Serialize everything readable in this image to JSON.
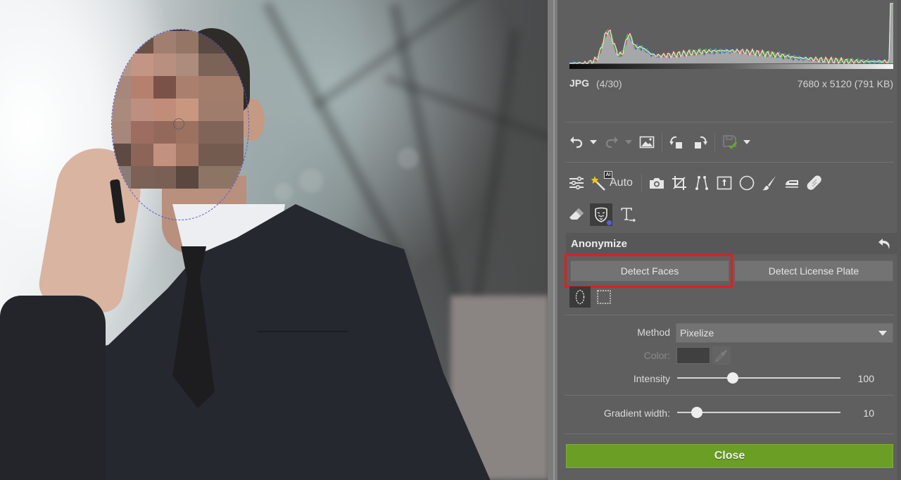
{
  "image": {
    "alt": "Man in dark suit on phone with pixelated face",
    "face_pixel_colors": [
      [
        "#c7b4a8",
        "#4d3f3a",
        "#2e2a27",
        "#403530",
        "#8d7364",
        "#000000"
      ],
      [
        "#5a4740",
        "#6b5247",
        "#a17f70",
        "#957566",
        "#5a4a44",
        "#000000"
      ],
      [
        "#b69586",
        "#c39584",
        "#b98f80",
        "#ad8b7d",
        "#7b6358",
        "#000000"
      ],
      [
        "#a6877a",
        "#b5806d",
        "#7a5247",
        "#ab7f6e",
        "#a27d6c",
        "#000000"
      ],
      [
        "#a98a7c",
        "#bd8f80",
        "#c08d79",
        "#c99780",
        "#a07c6d",
        "#000000"
      ],
      [
        "#a6877a",
        "#9c6d60",
        "#93695c",
        "#9b7160",
        "#806457",
        "#000000"
      ],
      [
        "#5c4a43",
        "#8c6558",
        "#c2917f",
        "#a57866",
        "#735b50",
        "#000000"
      ],
      [
        "#8a7d76",
        "#7c6157",
        "#7a5f54",
        "#5a4740",
        "#8d7566",
        "#000000"
      ]
    ]
  },
  "histogram": {
    "channels": [
      "luminance",
      "red",
      "green",
      "blue"
    ],
    "colors": {
      "luminance": "#e6e6e6",
      "red": "#d23b3b",
      "green": "#3bc23b",
      "blue": "#4b52d6",
      "fill": "#a5a7a8"
    }
  },
  "file_info": {
    "type": "JPG",
    "index": "(4/30)",
    "dimensions": "7680 x 5120 (791 KB)"
  },
  "toolbar_top": {
    "items": [
      {
        "name": "undo-button",
        "icon": "undo-icon"
      },
      {
        "name": "undo-history-dropdown",
        "icon": "caret-down-icon"
      },
      {
        "name": "redo-button",
        "icon": "redo-icon",
        "disabled": true
      },
      {
        "name": "redo-history-dropdown",
        "icon": "caret-down-icon",
        "disabled": true
      },
      {
        "name": "original-image-button",
        "icon": "image-icon"
      },
      {
        "name": "rotate-left-button",
        "icon": "rotate-left-icon"
      },
      {
        "name": "rotate-right-button",
        "icon": "rotate-right-icon"
      },
      {
        "name": "save-button",
        "icon": "save-check-icon",
        "disabled": true
      },
      {
        "name": "save-options-dropdown",
        "icon": "caret-down-icon"
      }
    ]
  },
  "toolbar_tools": {
    "auto_label": "Auto",
    "ai_badge": "AI"
  },
  "anonymize": {
    "title": "Anonymize",
    "detect_faces_label": "Detect Faces",
    "detect_plate_label": "Detect License Plate",
    "method_label": "Method",
    "method_value": "Pixelize",
    "color_label": "Color:",
    "color_value": "#404040",
    "intensity_label": "Intensity",
    "intensity_value": "100",
    "intensity_fraction": 0.34,
    "gradient_label": "Gradient width:",
    "gradient_value": "10",
    "gradient_fraction": 0.12,
    "close_label": "Close"
  },
  "colors": {
    "panel_bg": "#5f5f5f",
    "accent_green": "#6b9e24",
    "highlight_red": "#e01f1f",
    "selection_outline": "#5659c9"
  }
}
